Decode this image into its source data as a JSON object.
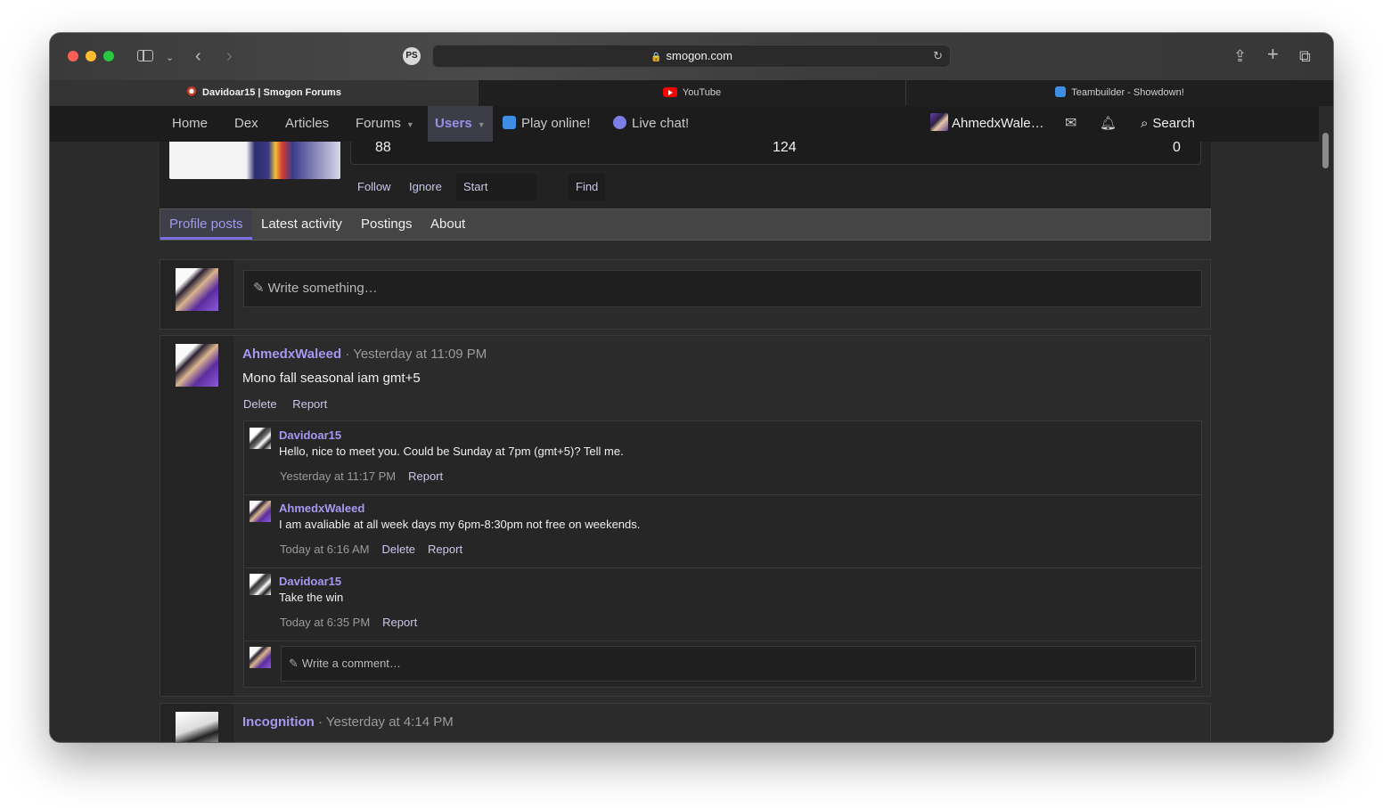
{
  "browser": {
    "url": "smogon.com",
    "ps_badge": "PS",
    "tabs": [
      {
        "title": "Davidoar15 | Smogon Forums",
        "favicon": "smogon-icon"
      },
      {
        "title": "YouTube",
        "favicon": "youtube-icon"
      },
      {
        "title": "Teambuilder - Showdown!",
        "favicon": "showdown-icon"
      }
    ]
  },
  "nav": {
    "home": "Home",
    "dex": "Dex",
    "articles": "Articles",
    "forums": "Forums",
    "users": "Users",
    "play_online": "Play online!",
    "live_chat": "Live chat!",
    "user": "AhmedxWale…",
    "search": "Search"
  },
  "profile": {
    "stats": [
      "88",
      "124",
      "0"
    ],
    "actions": {
      "follow": "Follow",
      "ignore": "Ignore",
      "start_conversation": "Start conversation",
      "find": "Find"
    },
    "tabs": [
      "Profile posts",
      "Latest activity",
      "Postings",
      "About"
    ]
  },
  "write_box": {
    "placeholder": "Write something…"
  },
  "posts": [
    {
      "author": "AhmedxWaleed",
      "time": "· Yesterday at 11:09 PM",
      "body": "Mono fall seasonal iam gmt+5",
      "actions": [
        "Delete",
        "Report"
      ],
      "comments": [
        {
          "author": "Davidoar15",
          "text": "Hello, nice to meet you. Could be Sunday at 7pm (gmt+5)? Tell me.",
          "time": "Yesterday at 11:17 PM",
          "actions": [
            "Report"
          ]
        },
        {
          "author": "AhmedxWaleed",
          "text": "I am avaliable at all week days my 6pm-8:30pm not free on weekends.",
          "time": "Today at 6:16 AM",
          "actions": [
            "Delete",
            "Report"
          ]
        },
        {
          "author": "Davidoar15",
          "text": "Take the win",
          "time": "Today at 6:35 PM",
          "actions": [
            "Report"
          ]
        }
      ],
      "comment_placeholder": "Write a comment…"
    },
    {
      "author": "Incognition",
      "time": "· Yesterday at 4:14 PM"
    }
  ],
  "colors": {
    "accent": "#a598f0",
    "background": "#2b2b2b",
    "nav_bg": "#1c1c1c"
  }
}
